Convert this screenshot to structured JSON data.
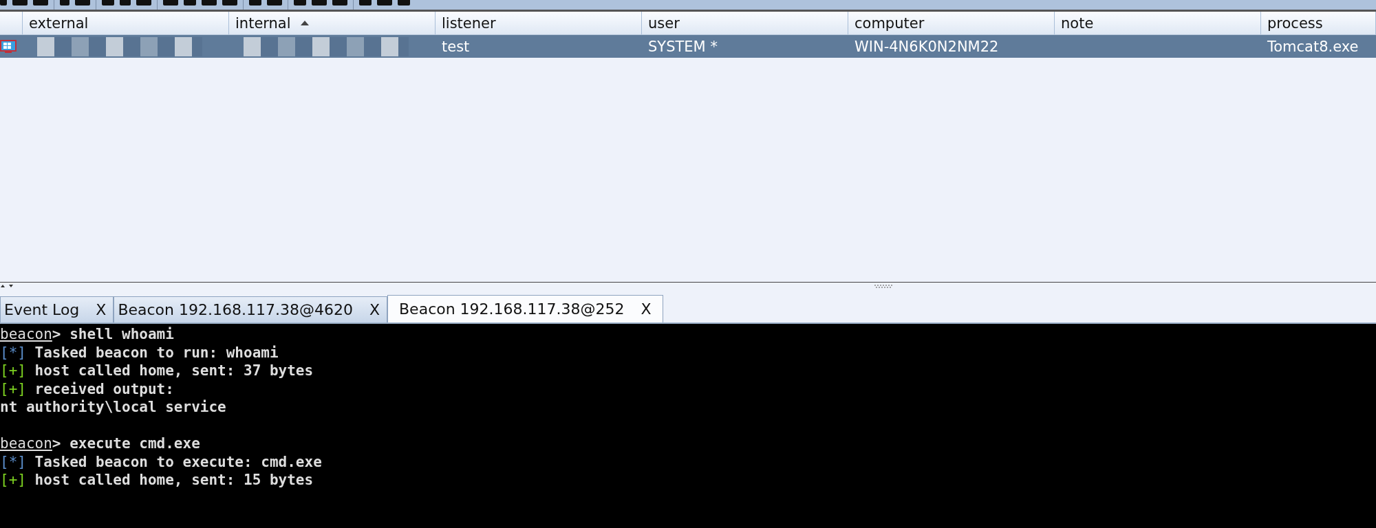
{
  "table": {
    "columns": [
      {
        "label": "external",
        "sorted": false
      },
      {
        "label": "internal",
        "sorted": true
      },
      {
        "label": "listener",
        "sorted": false
      },
      {
        "label": "user",
        "sorted": false
      },
      {
        "label": "computer",
        "sorted": false
      },
      {
        "label": "note",
        "sorted": false
      },
      {
        "label": "process",
        "sorted": false
      }
    ],
    "rows": [
      {
        "selected": true,
        "redacted": [
          true,
          true,
          false,
          false,
          false,
          false,
          false
        ],
        "cells": [
          "",
          "",
          "test",
          "SYSTEM *",
          "WIN-4N6K0N2NM22",
          "",
          "Tomcat8.exe"
        ]
      }
    ]
  },
  "tabs": [
    {
      "label": "Event Log",
      "close": "X",
      "selected": false
    },
    {
      "label": "Beacon 192.168.117.38@4620",
      "close": "X",
      "selected": false
    },
    {
      "label": "Beacon 192.168.117.38@252",
      "close": "X",
      "selected": true
    }
  ],
  "console": {
    "lines": [
      {
        "kind": "prompt",
        "prompt": "beacon",
        "text": "> shell whoami"
      },
      {
        "kind": "info",
        "mark": "[*]",
        "text": " Tasked beacon to run: whoami"
      },
      {
        "kind": "success",
        "mark": "[+]",
        "text": " host called home, sent: 37 bytes"
      },
      {
        "kind": "success",
        "mark": "[+]",
        "text": " received output:"
      },
      {
        "kind": "output",
        "text": "nt authority\\local service"
      },
      {
        "kind": "blank"
      },
      {
        "kind": "prompt",
        "prompt": "beacon",
        "text": "> execute cmd.exe"
      },
      {
        "kind": "info",
        "mark": "[*]",
        "text": " Tasked beacon to execute: cmd.exe"
      },
      {
        "kind": "success",
        "mark": "[+]",
        "text": " host called home, sent: 15 bytes"
      }
    ]
  }
}
